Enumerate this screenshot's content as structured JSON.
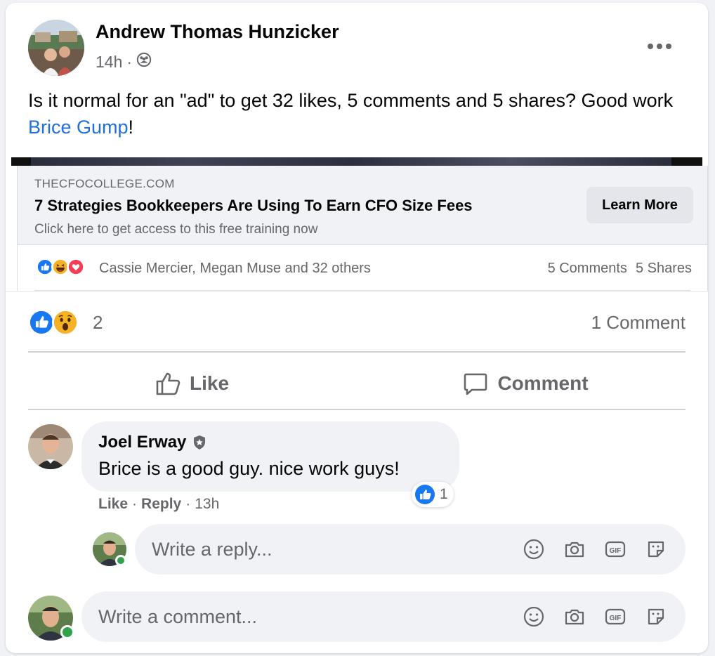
{
  "post": {
    "author": "Andrew Thomas Hunzicker",
    "time": "14h",
    "separator": "·",
    "text_before": "Is it normal for an \"ad\" to get 32 likes, 5 comments and 5 shares? Good work ",
    "mention": "Brice Gump",
    "text_after": "!"
  },
  "shared": {
    "domain": "THECFOCOLLEGE.COM",
    "title": "7 Strategies Bookkeepers Are Using To Earn CFO Size Fees",
    "description": "Click here to get access to this free training now",
    "cta": "Learn More",
    "reaction_names": "Cassie Mercier, Megan Muse and 32 others",
    "comments": "5 Comments",
    "shares": "5 Shares"
  },
  "reactions": {
    "count": "2",
    "comments": "1 Comment"
  },
  "actions": {
    "like": "Like",
    "comment": "Comment"
  },
  "comment": {
    "author": "Joel Erway",
    "text": "Brice is a good guy. nice work guys!",
    "reaction_count": "1",
    "like": "Like",
    "reply": "Reply",
    "time": "13h",
    "dot": "·"
  },
  "reply_input": {
    "placeholder": "Write a reply..."
  },
  "comment_input": {
    "placeholder": "Write a comment..."
  },
  "colors": {
    "link_blue": "#216fdb",
    "like_blue": "#1877f2",
    "heart_red": "#f33e58",
    "wow_yellow": "#f7b125",
    "online_green": "#31a24c"
  }
}
